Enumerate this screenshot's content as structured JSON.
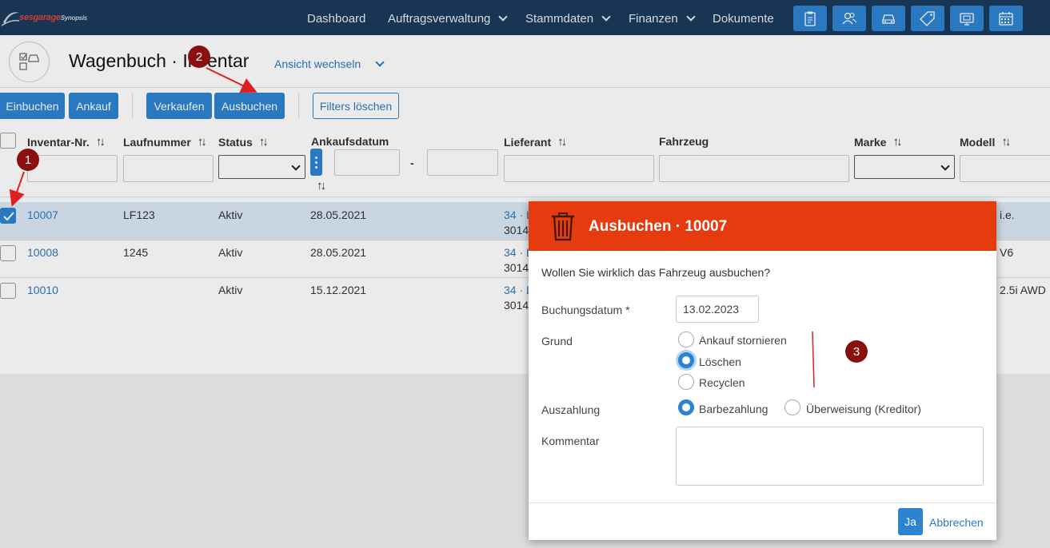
{
  "logo": {
    "part1": "sesgarage",
    "part2": "Synopsis"
  },
  "nav": {
    "items": [
      {
        "label": "Dashboard",
        "has_dropdown": false
      },
      {
        "label": "Auftragsverwaltung",
        "has_dropdown": true
      },
      {
        "label": "Stammdaten",
        "has_dropdown": true
      },
      {
        "label": "Finanzen",
        "has_dropdown": true
      },
      {
        "label": "Dokumente",
        "has_dropdown": false
      }
    ],
    "icon_buttons": [
      "clipboard-icon",
      "users-icon",
      "car-icon",
      "tag-icon",
      "monitor-icon",
      "calendar-icon"
    ]
  },
  "header": {
    "title": "Wagenbuch · Inventar",
    "view_switch": "Ansicht wechseln"
  },
  "toolbar": {
    "einbuchen": "Einbuchen",
    "ankauf": "Ankauf",
    "verkaufen": "Verkaufen",
    "ausbuchen": "Ausbuchen",
    "filters_loeschen": "Filters löschen"
  },
  "table": {
    "columns": [
      "Inventar-Nr.",
      "Laufnummer",
      "Status",
      "Ankaufsdatum",
      "Lieferant",
      "Fahrzeug",
      "Marke",
      "Modell"
    ],
    "date_separator": "-",
    "rows": [
      {
        "inventar": "10007",
        "laufnummer": "LF123",
        "status": "Aktiv",
        "datum": "28.05.2021",
        "lieferant_1": "34 · L",
        "lieferant_2": "3014",
        "modell": "i.e.",
        "selected": true
      },
      {
        "inventar": "10008",
        "laufnummer": "1245",
        "status": "Aktiv",
        "datum": "28.05.2021",
        "lieferant_1": "34 · L",
        "lieferant_2": "3014",
        "modell": "V6",
        "selected": false
      },
      {
        "inventar": "10010",
        "laufnummer": "",
        "status": "Aktiv",
        "datum": "15.12.2021",
        "lieferant_1": "34 · L",
        "lieferant_2": "3014",
        "modell": "2.5i AWD",
        "selected": false
      }
    ]
  },
  "modal": {
    "title": "Ausbuchen · 10007",
    "question": "Wollen Sie wirklich das Fahrzeug ausbuchen?",
    "buchungsdatum_label": "Buchungsdatum *",
    "buchungsdatum_value": "13.02.2023",
    "grund_label": "Grund",
    "grund_options": [
      "Ankauf stornieren",
      "Löschen",
      "Recyclen"
    ],
    "grund_selected": "Löschen",
    "auszahlung_label": "Auszahlung",
    "auszahlung_options": [
      "Barbezahlung",
      "Überweisung (Kreditor)"
    ],
    "auszahlung_selected": "Barbezahlung",
    "kommentar_label": "Kommentar",
    "kommentar_value": "",
    "ja": "Ja",
    "abbrechen": "Abbrechen"
  },
  "annotations": {
    "badge1": "1",
    "badge2": "2",
    "badge3": "3"
  },
  "colors": {
    "nav_bg": "#1b3a5c",
    "accent": "#2e83d0",
    "modal_header": "#e53b0f",
    "badge": "#8a0f0f",
    "arrow": "#e02020"
  }
}
